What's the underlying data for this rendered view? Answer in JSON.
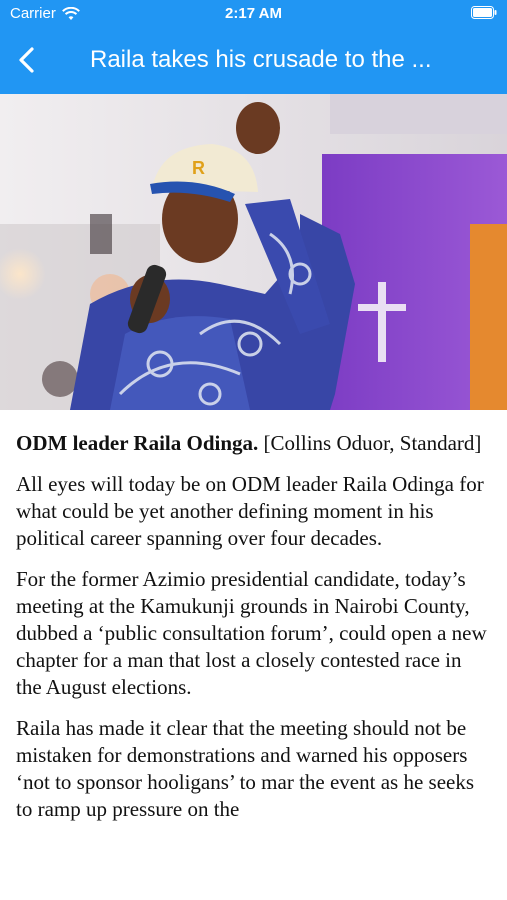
{
  "status_bar": {
    "carrier": "Carrier",
    "time": "2:17 AM"
  },
  "nav": {
    "title": "Raila takes his crusade to the ..."
  },
  "article": {
    "caption_bold": "ODM leader Raila Odinga.",
    "caption_credit": " [Collins Oduor, Standard]",
    "paragraphs": [
      "All eyes will today be on ODM leader Raila Odinga for what could be yet another defining moment in his political career spanning over four decades.",
      "For the former Azimio presidential candidate, today’s meeting at the Kamukunji grounds in Nairobi County, dubbed a ‘public consultation forum’, could open a new chapter for a man that lost a closely contested race in the August elections.",
      "Raila has made it clear that the meeting should not be mistaken for demonstrations and warned his opposers ‘not to sponsor hooligans’ to mar the event as he seeks to ramp up pressure on the"
    ]
  },
  "colors": {
    "nav_background": "#2196f3",
    "nav_text": "#ffffff"
  },
  "icons": [
    "wifi-icon",
    "battery-icon",
    "back-chevron-icon"
  ]
}
